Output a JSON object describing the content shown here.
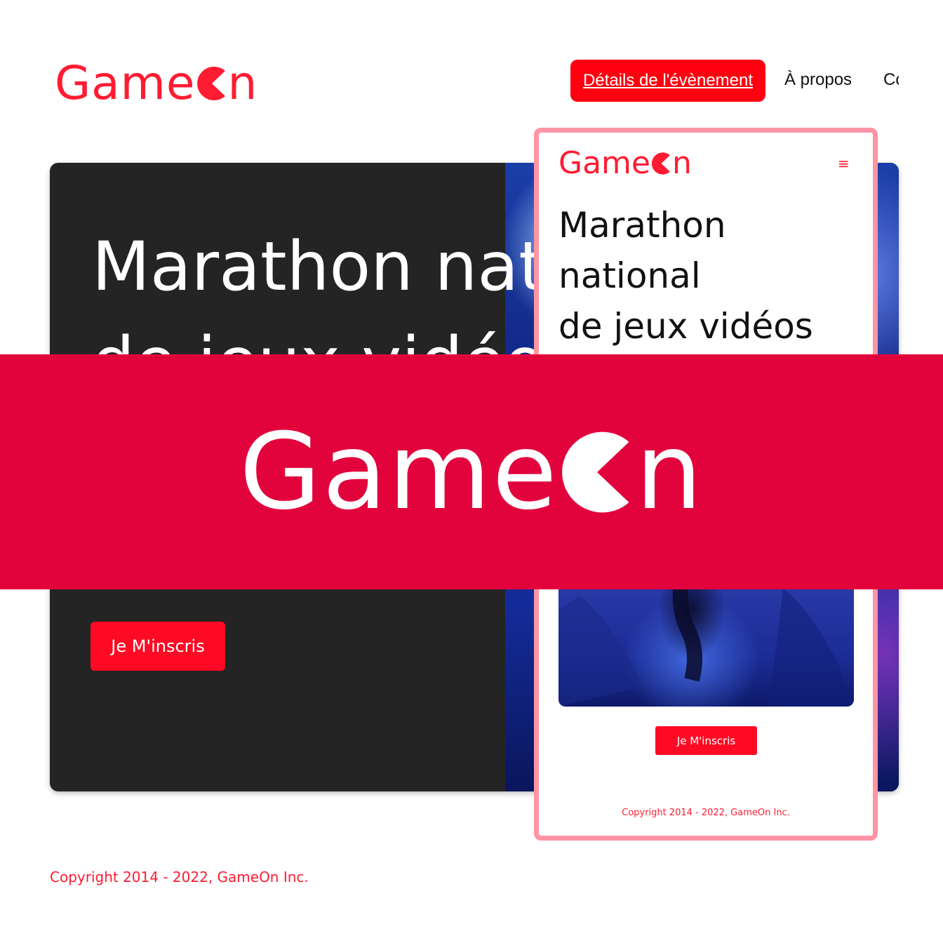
{
  "brand": {
    "logo_prefix": "Game",
    "logo_suffix": "n",
    "color": "#ff1c32"
  },
  "nav": {
    "items": [
      {
        "label": "Détails de l'évènement",
        "active": true
      },
      {
        "label": "À propos"
      },
      {
        "label": "Co"
      }
    ],
    "active_color": "#ff0010"
  },
  "hero": {
    "title_line1": "Marathon nat",
    "title_line2": "de jeux vidéo",
    "cta_label": "Je M'inscris",
    "background_color": "#242424"
  },
  "footer": {
    "copyright": "Copyright 2014 - 2022, GameOn Inc."
  },
  "mobile": {
    "menu_icon": "hamburger-icon",
    "title_line1": "Marathon",
    "title_line2": "national",
    "title_line3": "de jeux vidéos",
    "cta_label": "Je M'inscris",
    "copyright": "Copyright 2014 - 2022, GameOn Inc.",
    "frame_color": "#ff94a4"
  },
  "banner": {
    "color": "#e2033c"
  }
}
